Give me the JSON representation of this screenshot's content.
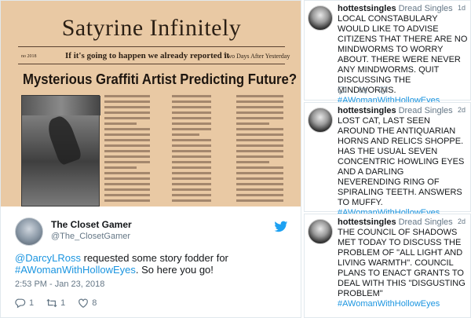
{
  "newspaper": {
    "title": "Satyrine Infinitely",
    "date": "no 2018",
    "tagline": "If it's going to happen we already reported it",
    "edition": "Two Days After Yesterday",
    "headline": "Mysterious Graffiti Artist Predicting Future?"
  },
  "main_tweet": {
    "author_name": "The Closet Gamer",
    "author_handle": "@The_ClosetGamer",
    "mention": "@DarcyLRoss",
    "text_mid": " requested some story fodder for",
    "hashtag": "#AWomanWithHollowEyes",
    "text_end": ". So here you go!",
    "timestamp": "2:53 PM - Jan 23, 2018",
    "replies": "1",
    "retweets": "1",
    "likes": "8"
  },
  "side_tweets": [
    {
      "name": "hottestsingles",
      "display": "Dread Singles",
      "time": "1d",
      "text": "LOCAL CONSTABULARY WOULD LIKE TO ADVISE CITIZENS THAT THERE ARE NO MINDWORMS TO WORRY ABOUT. THERE WERE NEVER ANY MINDWORMS. QUIT DISCUSSING THE MINDWORMS.",
      "hashtag": "#AWomanWithHollowEyes"
    },
    {
      "name": "hottestsingles",
      "display": "Dread Singles",
      "time": "2d",
      "text": "LOST CAT, LAST SEEN AROUND THE ANTIQUARIAN HORNS AND RELICS SHOPPE. HAS THE USUAL SEVEN CONCENTRIC HOWLING EYES AND A DARLING NEVERENDING RING OF SPIRALING TEETH. ANSWERS TO MUFFY.",
      "hashtag": "#AWomanWithHollowEyes"
    },
    {
      "name": "hottestsingles",
      "display": "Dread Singles",
      "time": "2d",
      "text": "THE COUNCIL OF SHADOWS MET TODAY TO DISCUSS THE PROBLEM OF \"ALL LIGHT AND LIVING WARMTH\". COUNCIL PLANS TO ENACT GRANTS TO DEAL WITH THIS \"DISGUSTING PROBLEM\"",
      "hashtag": "#AWomanWithHollowEyes"
    }
  ],
  "colors": {
    "link": "#1b95e0",
    "text": "#14171a",
    "muted": "#657786",
    "paper": "#e9c9a4"
  }
}
